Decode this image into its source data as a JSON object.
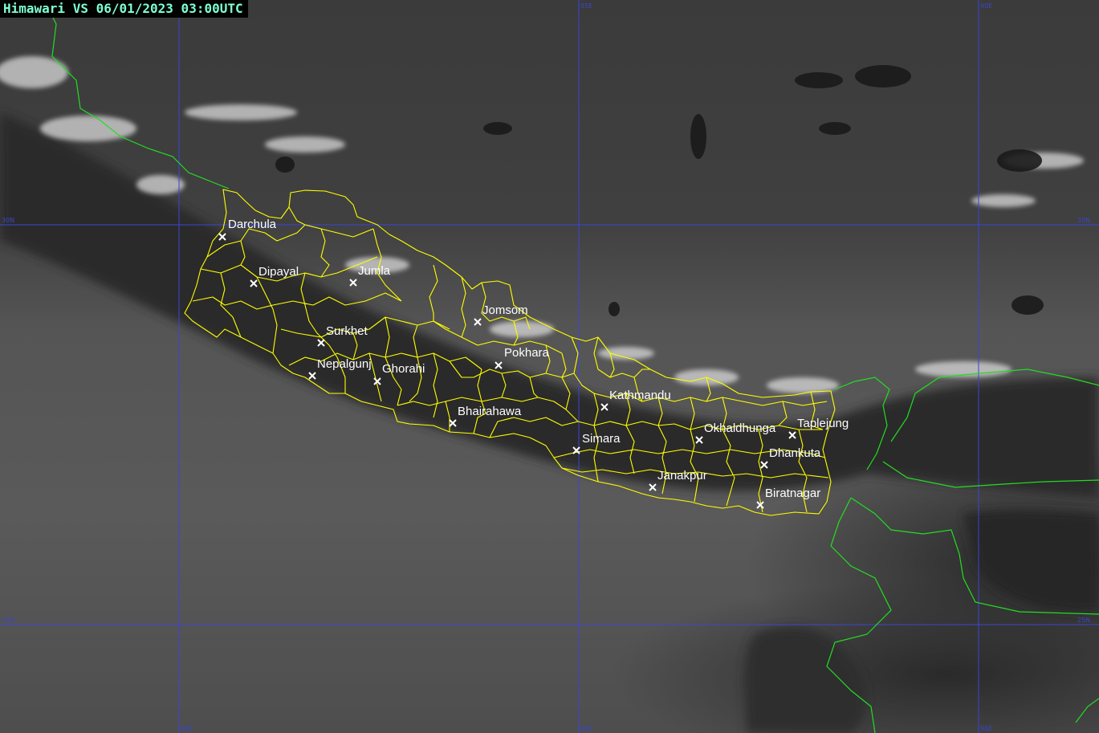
{
  "title": "Himawari VS 06/01/2023 03:00UTC",
  "colors": {
    "gridline": "#3b45d6",
    "district_boundary": "#ffff00",
    "international_border": "#22dd22",
    "city_marker": "#ffffff",
    "title_text": "#7fffd4"
  },
  "grid_labels": {
    "lon_80": "80E",
    "lon_85": "85E",
    "lon_90": "90E",
    "lat_30": "30N",
    "lat_25": "25N"
  },
  "cities": [
    "Darchula",
    "Dipayal",
    "Jumla",
    "Jomsom",
    "Surkhet",
    "Pokhara",
    "Nepalgunj",
    "Ghorahi",
    "Bhairahawa",
    "Kathmandu",
    "Simara",
    "Okhaldhunga",
    "Taplejung",
    "Dhankuta",
    "Janakpur",
    "Biratnagar"
  ]
}
